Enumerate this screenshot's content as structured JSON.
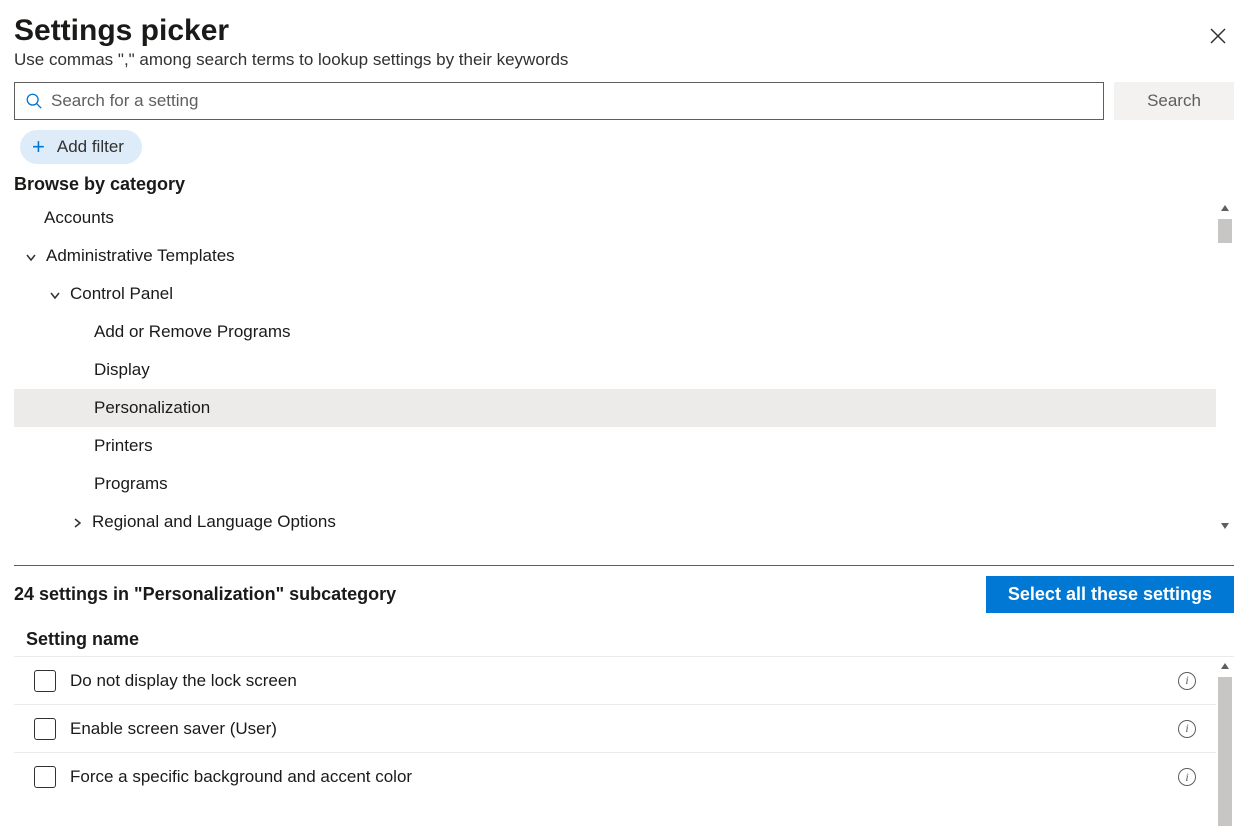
{
  "header": {
    "title": "Settings picker",
    "subtitle": "Use commas \",\" among search terms to lookup settings by their keywords"
  },
  "search": {
    "placeholder": "Search for a setting",
    "button": "Search"
  },
  "filter": {
    "add_label": "Add filter"
  },
  "browse": {
    "label": "Browse by category",
    "accounts": "Accounts",
    "admin_templates": "Administrative Templates",
    "control_panel": "Control Panel",
    "add_remove": "Add or Remove Programs",
    "display": "Display",
    "personalization": "Personalization",
    "printers": "Printers",
    "programs": "Programs",
    "regional": "Regional and Language Options"
  },
  "results": {
    "count_text": "24 settings in \"Personalization\" subcategory",
    "select_all": "Select all these settings",
    "column_header": "Setting name",
    "items": [
      "Do not display the lock screen",
      "Enable screen saver (User)",
      "Force a specific background and accent color"
    ]
  }
}
